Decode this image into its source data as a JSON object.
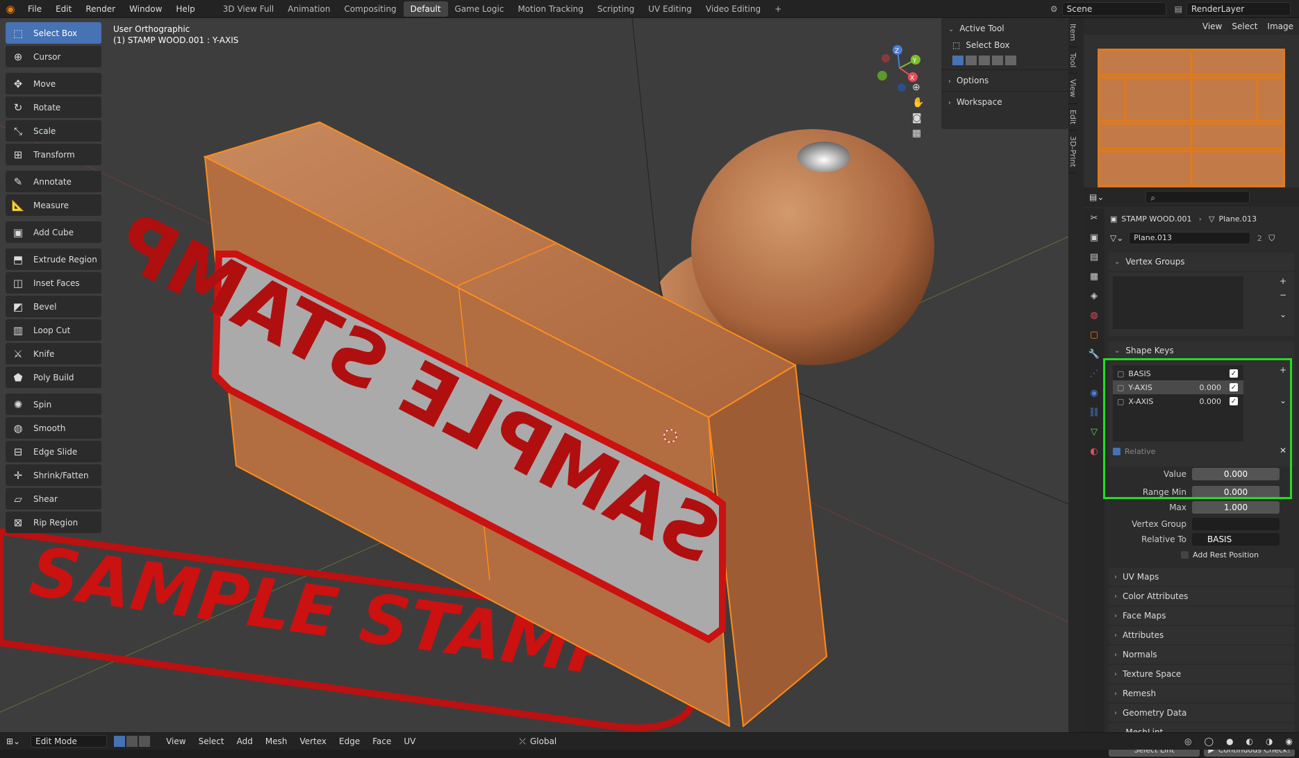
{
  "menus": [
    "File",
    "Edit",
    "Render",
    "Window",
    "Help"
  ],
  "workspaces": [
    "3D View Full",
    "Animation",
    "Compositing",
    "Default",
    "Game Logic",
    "Motion Tracking",
    "Scripting",
    "UV Editing",
    "Video Editing"
  ],
  "active_workspace": "Default",
  "scene": "Scene",
  "render_layer": "RenderLayer",
  "viewport": {
    "title": "User Orthographic",
    "subtitle": "(1) STAMP WOOD.001 : Y-AXIS",
    "floor_text": "SAMPLE STAMP",
    "stamp_text": "SAMPLE STAMP"
  },
  "tools": [
    {
      "label": "Select Box",
      "icon": "select-box-icon",
      "active": true
    },
    {
      "label": "Cursor",
      "icon": "cursor-icon"
    },
    {
      "label": "Move",
      "icon": "move-icon"
    },
    {
      "label": "Rotate",
      "icon": "rotate-icon"
    },
    {
      "label": "Scale",
      "icon": "scale-icon"
    },
    {
      "label": "Transform",
      "icon": "transform-icon"
    },
    {
      "label": "Annotate",
      "icon": "annotate-icon"
    },
    {
      "label": "Measure",
      "icon": "measure-icon"
    },
    {
      "label": "Add Cube",
      "icon": "add-cube-icon"
    },
    {
      "label": "Extrude Region",
      "icon": "extrude-icon"
    },
    {
      "label": "Inset Faces",
      "icon": "inset-icon"
    },
    {
      "label": "Bevel",
      "icon": "bevel-icon"
    },
    {
      "label": "Loop Cut",
      "icon": "loop-cut-icon"
    },
    {
      "label": "Knife",
      "icon": "knife-icon"
    },
    {
      "label": "Poly Build",
      "icon": "poly-build-icon"
    },
    {
      "label": "Spin",
      "icon": "spin-icon"
    },
    {
      "label": "Smooth",
      "icon": "smooth-icon"
    },
    {
      "label": "Edge Slide",
      "icon": "edge-slide-icon"
    },
    {
      "label": "Shrink/Fatten",
      "icon": "shrink-icon"
    },
    {
      "label": "Shear",
      "icon": "shear-icon"
    },
    {
      "label": "Rip Region",
      "icon": "rip-icon"
    }
  ],
  "npanel": {
    "active_tool": "Active Tool",
    "tool_name": "Select Box",
    "options": "Options",
    "workspace": "Workspace"
  },
  "ntabs": [
    "Item",
    "Tool",
    "View",
    "Edit",
    "3D-Print"
  ],
  "uv_menu": [
    "View",
    "Select",
    "Image"
  ],
  "props": {
    "object": "STAMP WOOD.001",
    "mesh": "Plane.013",
    "mesh_field": "Plane.013",
    "users": "2",
    "vertex_groups": "Vertex Groups",
    "shape_keys": "Shape Keys",
    "keys": [
      {
        "name": "BASIS",
        "value": ""
      },
      {
        "name": "Y-AXIS",
        "value": "0.000",
        "selected": true
      },
      {
        "name": "X-AXIS",
        "value": "0.000"
      }
    ],
    "relative": "Relative",
    "value_label": "Value",
    "value": "0.000",
    "range_min_label": "Range Min",
    "range_min": "0.000",
    "max_label": "Max",
    "max": "1.000",
    "vertex_group_label": "Vertex Group",
    "relative_to_label": "Relative To",
    "relative_to": "BASIS",
    "add_rest": "Add Rest Position",
    "sections": [
      "UV Maps",
      "Color Attributes",
      "Face Maps",
      "Attributes",
      "Normals",
      "Texture Space",
      "Remesh",
      "Geometry Data"
    ],
    "meshlint": "MeshLint",
    "select_lint": "Select Lint",
    "continuous_check": "Continuous Check!"
  },
  "status": {
    "mode": "Edit Mode",
    "menus": [
      "View",
      "Select",
      "Add",
      "Mesh",
      "Vertex",
      "Edge",
      "Face",
      "UV"
    ],
    "orientation": "Global"
  },
  "colors": {
    "accent": "#4772b3",
    "highlight": "#22dd22",
    "select": "#ff8c1a",
    "stamp_red": "#cc1111"
  }
}
